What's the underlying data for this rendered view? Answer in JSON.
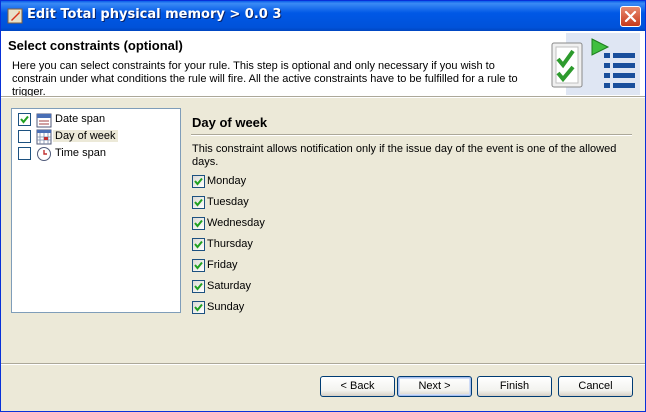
{
  "window": {
    "title": "Edit Total physical memory > 0.0 3",
    "close_glyph": "✕"
  },
  "header": {
    "title": "Select constraints (optional)",
    "description": "Here you can select constraints for your rule. This step is optional and only necessary if you wish to constrain under what conditions the rule will fire. All the active constraints have to be fulfilled for a rule to trigger.",
    "graphic_icon": "checklist-run-icon"
  },
  "constraints": [
    {
      "label": "Date span",
      "checked": true,
      "icon": "calendar-icon",
      "selected": false
    },
    {
      "label": "Day of week",
      "checked": false,
      "icon": "calendar-grid-icon",
      "selected": true
    },
    {
      "label": "Time span",
      "checked": false,
      "icon": "clock-icon",
      "selected": false
    }
  ],
  "panel": {
    "title": "Day of week",
    "description": "This constraint allows notification only if the issue day of the event is one of the allowed days.",
    "days": [
      {
        "label": "Monday",
        "checked": true
      },
      {
        "label": "Tuesday",
        "checked": true
      },
      {
        "label": "Wednesday",
        "checked": true
      },
      {
        "label": "Thursday",
        "checked": true
      },
      {
        "label": "Friday",
        "checked": true
      },
      {
        "label": "Saturday",
        "checked": true
      },
      {
        "label": "Sunday",
        "checked": true
      }
    ]
  },
  "buttons": {
    "back": "< Back",
    "next": "Next >",
    "finish": "Finish",
    "cancel": "Cancel"
  },
  "colors": {
    "titlebar": "#0058e6",
    "check": "#21a121",
    "close": "#c8391a"
  }
}
